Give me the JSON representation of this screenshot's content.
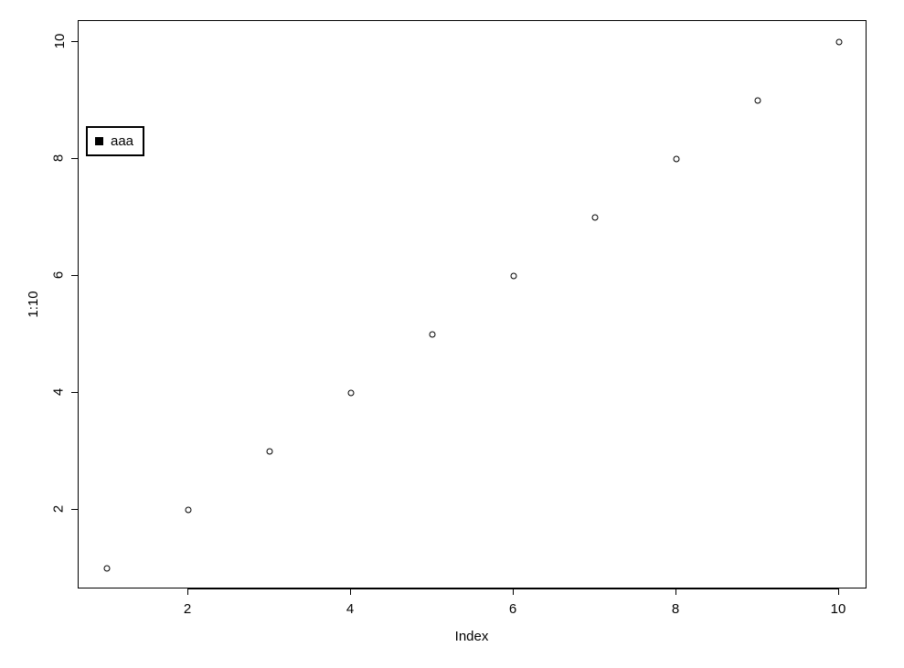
{
  "chart_data": {
    "type": "scatter",
    "x": [
      1,
      2,
      3,
      4,
      5,
      6,
      7,
      8,
      9,
      10
    ],
    "y": [
      1,
      2,
      3,
      4,
      5,
      6,
      7,
      8,
      9,
      10
    ],
    "xlabel": "Index",
    "ylabel": "1:10",
    "xlim": [
      1,
      10
    ],
    "ylim": [
      1,
      10
    ],
    "xticks": [
      2,
      4,
      6,
      8,
      10
    ],
    "yticks": [
      2,
      4,
      6,
      8,
      10
    ],
    "legend": {
      "position": "topleft",
      "entries": [
        {
          "label": "aaa",
          "marker": "square",
          "color": "#000000"
        }
      ]
    }
  },
  "labels": {
    "xlabel": "Index",
    "ylabel": "1:10",
    "legend_0": "aaa",
    "xtick_0": "2",
    "xtick_1": "4",
    "xtick_2": "6",
    "xtick_3": "8",
    "xtick_4": "10",
    "ytick_0": "2",
    "ytick_1": "4",
    "ytick_2": "6",
    "ytick_3": "8",
    "ytick_4": "10"
  }
}
